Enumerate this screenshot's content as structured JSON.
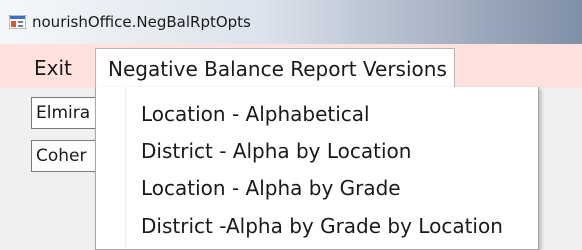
{
  "window": {
    "title": "nourishOffice.NegBalRptOpts",
    "icon": "app-window-icon"
  },
  "menubar": {
    "exit_label": "Exit",
    "reports_label": "Negative Balance Report Versions"
  },
  "fields": {
    "field1_value": "Elmira",
    "field2_value": "Coher"
  },
  "dropdown": {
    "items": [
      {
        "label": "Location - Alphabetical"
      },
      {
        "label": "District - Alpha by Location"
      },
      {
        "label": "Location - Alpha by Grade"
      },
      {
        "label": "District  -Alpha by Grade by Location"
      }
    ]
  },
  "colors": {
    "menubar_bg": "#ffe2de",
    "content_bg": "#f0f0f0"
  }
}
